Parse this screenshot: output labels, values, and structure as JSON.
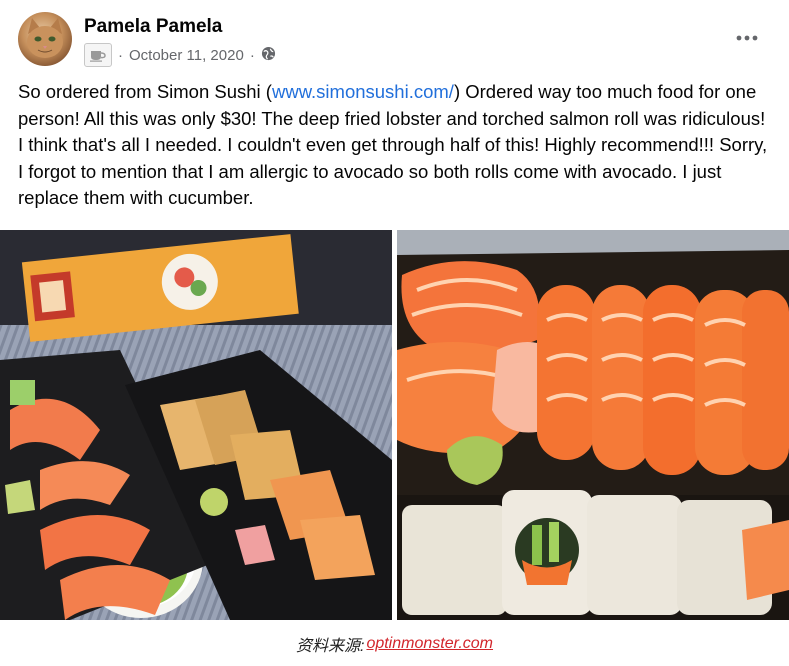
{
  "post": {
    "author": "Pamela Pamela",
    "date": "October 11, 2020",
    "separator": "·",
    "text_before_link": "So ordered from Simon Sushi (",
    "link_text": "www.simonsushi.com/",
    "text_after_link": ")  Ordered way too much food for one person! All this was only $30! The deep fried lobster and torched salmon roll was ridiculous! I think that's all I needed. I couldn't even get through half of this! Highly recommend!!! Sorry, I forgot to mention that I am allergic to avocado so both rolls come with avocado. I just replace them with cucumber.",
    "icons": {
      "avatar": "cat-avatar",
      "badge": "coffee-cup-icon",
      "audience": "globe-icon",
      "more": "more-options-icon"
    },
    "photos": [
      {
        "subject": "sushi-takeout-spread"
      },
      {
        "subject": "salmon-nigiri-and-rolls"
      }
    ]
  },
  "caption": {
    "label": "资料来源:",
    "link_text": "optinmonster.com"
  },
  "colors": {
    "link": "#216fdb",
    "meta_text": "#65676b",
    "caption_link": "#d2262c"
  }
}
